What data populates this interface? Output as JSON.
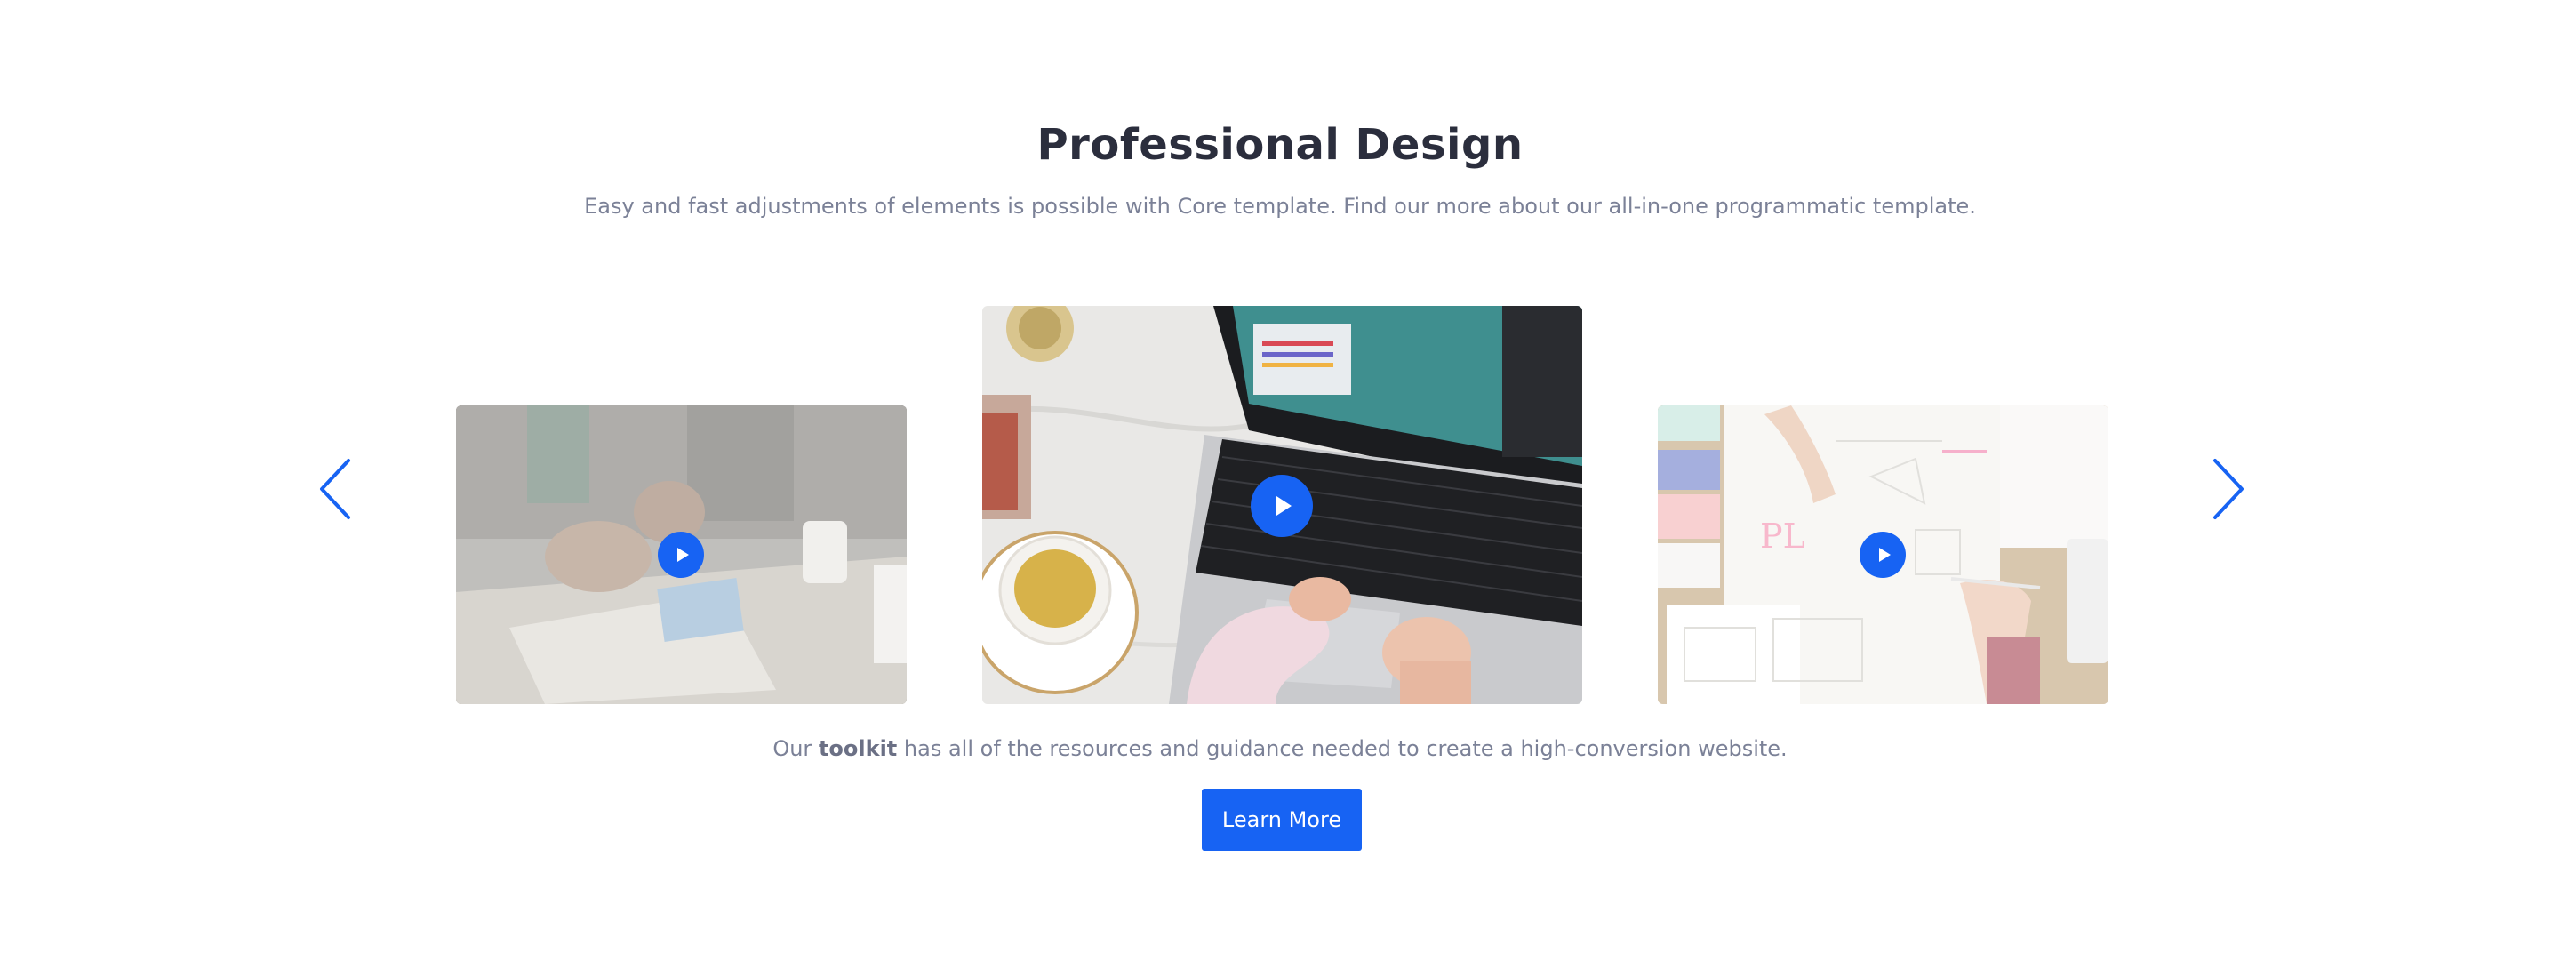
{
  "section": {
    "title": "Professional Design",
    "subtitle": "Easy and fast adjustments of elements is possible with Core template. Find our more about our all-in-one programmatic template."
  },
  "carousel": {
    "prev_icon": "chevron-left-icon",
    "next_icon": "chevron-right-icon",
    "accent_color": "#1763f3",
    "slides": [
      {
        "name": "team-planning-photo",
        "active": false
      },
      {
        "name": "laptop-coffee-photo",
        "active": true
      },
      {
        "name": "design-sketches-photo",
        "active": false
      }
    ]
  },
  "caption": {
    "before": "Our ",
    "bold": "toolkit",
    "after": " has all of the resources and guidance needed to create a high-conversion website."
  },
  "cta": {
    "label": "Learn More",
    "color": "#1763f3"
  }
}
